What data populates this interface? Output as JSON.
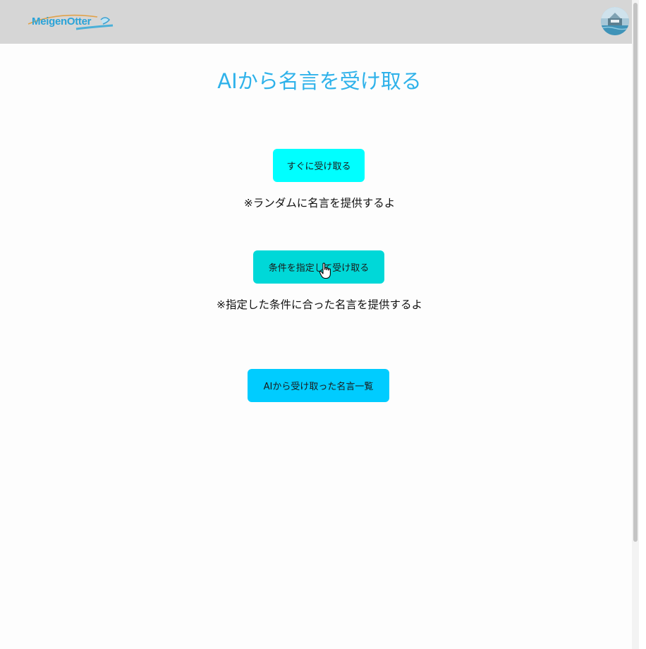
{
  "header": {
    "logo_text": "MeigenOtter"
  },
  "main": {
    "title": "AIから名言を受け取る",
    "instant_button_label": "すぐに受け取る",
    "instant_note": "※ランダムに名言を提供するよ",
    "conditional_button_label": "条件を指定して受け取る",
    "conditional_note": "※指定した条件に合った名言を提供するよ",
    "history_button_label": "AIから受け取った名言一覧"
  },
  "colors": {
    "header_bg": "#d6d6d6",
    "title": "#2fb2ea",
    "instant_button": "#00ffff",
    "conditional_button": "#00d8d8",
    "history_button": "#00ccff"
  },
  "icons": {
    "avatar": "profile-avatar",
    "cursor": "hand-pointer-icon"
  }
}
